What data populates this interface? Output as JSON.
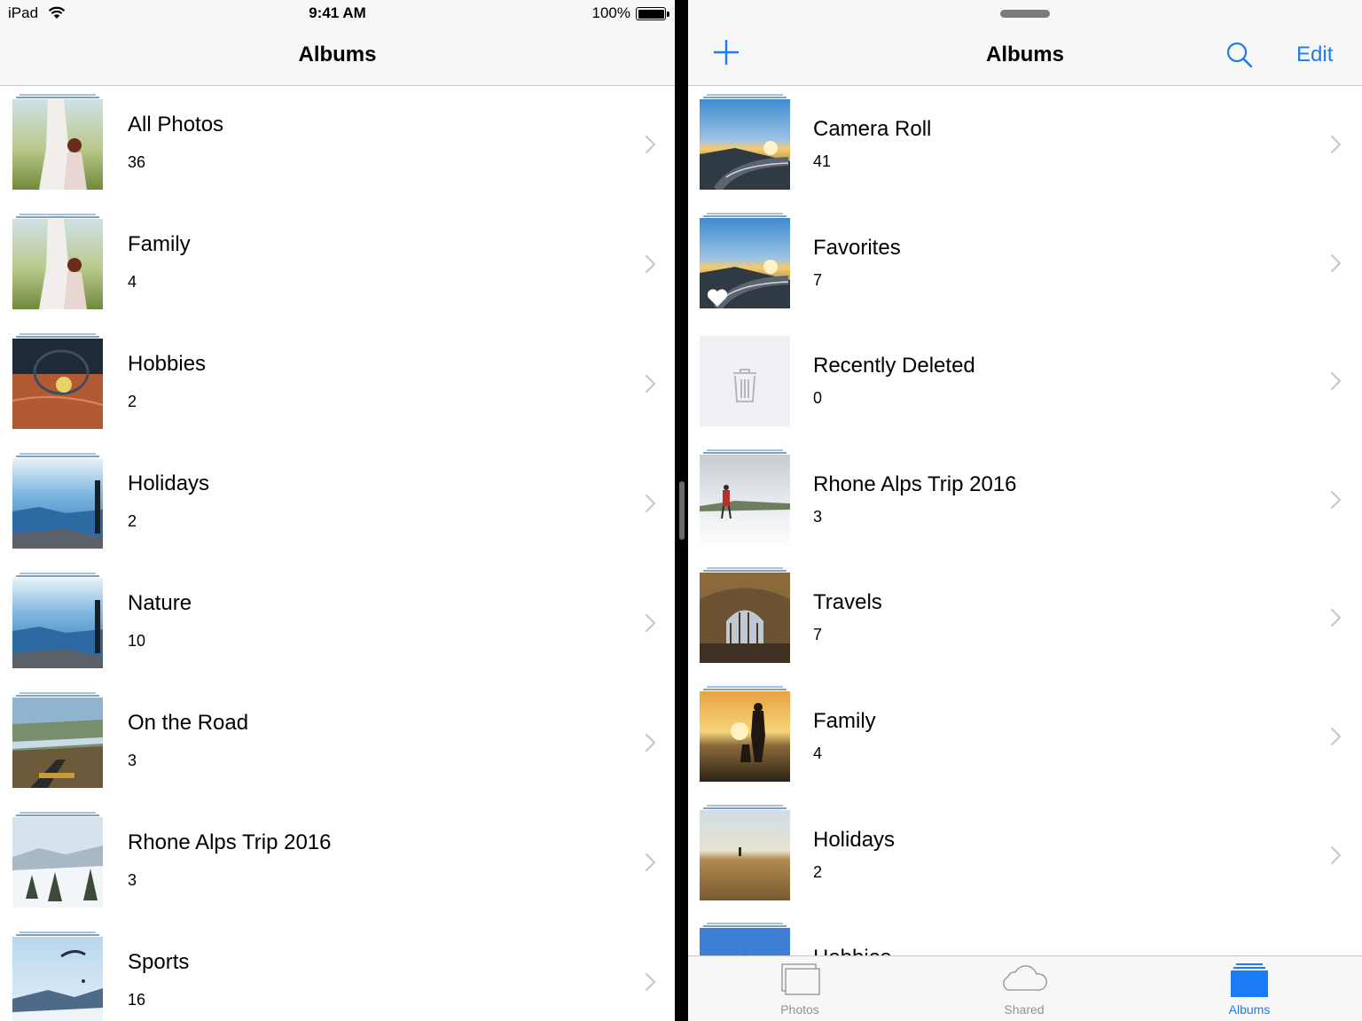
{
  "status_bar": {
    "device": "iPad",
    "time": "9:41 AM",
    "battery": "100%"
  },
  "left": {
    "title": "Albums",
    "albums": [
      {
        "name": "All Photos",
        "count": "36",
        "scene": "mother-daughter"
      },
      {
        "name": "Family",
        "count": "4",
        "scene": "mother-daughter"
      },
      {
        "name": "Hobbies",
        "count": "2",
        "scene": "tennis"
      },
      {
        "name": "Holidays",
        "count": "2",
        "scene": "canyon"
      },
      {
        "name": "Nature",
        "count": "10",
        "scene": "canyon"
      },
      {
        "name": "On the Road",
        "count": "3",
        "scene": "river-road"
      },
      {
        "name": "Rhone Alps Trip 2016",
        "count": "3",
        "scene": "snow-forest"
      },
      {
        "name": "Sports",
        "count": "16",
        "scene": "paraglider"
      }
    ]
  },
  "right": {
    "title": "Albums",
    "edit_label": "Edit",
    "albums": [
      {
        "name": "Camera Roll",
        "count": "41",
        "scene": "mountain-road"
      },
      {
        "name": "Favorites",
        "count": "7",
        "scene": "mountain-road"
      },
      {
        "name": "Recently Deleted",
        "count": "0",
        "scene": "trash"
      },
      {
        "name": "Rhone Alps Trip 2016",
        "count": "3",
        "scene": "snow-hiker"
      },
      {
        "name": "Travels",
        "count": "7",
        "scene": "station"
      },
      {
        "name": "Family",
        "count": "4",
        "scene": "sunset-family"
      },
      {
        "name": "Holidays",
        "count": "2",
        "scene": "field"
      },
      {
        "name": "Hobbies",
        "count": "",
        "scene": "blue-sky"
      }
    ],
    "tabs": [
      {
        "label": "Photos",
        "icon": "photos-icon"
      },
      {
        "label": "Shared",
        "icon": "cloud-icon"
      },
      {
        "label": "Albums",
        "icon": "albums-icon"
      }
    ],
    "active_tab": "Albums"
  },
  "colors": {
    "accent": "#1a7cf5",
    "tab_inactive": "#929292",
    "separator": "#c8c7cc"
  }
}
